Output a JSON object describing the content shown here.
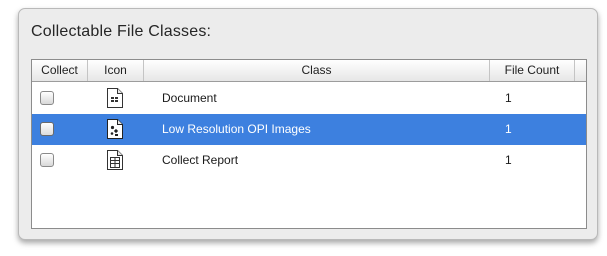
{
  "panel": {
    "title": "Collectable File Classes:"
  },
  "table": {
    "columns": {
      "collect": "Collect",
      "icon": "Icon",
      "class": "Class",
      "file_count": "File Count"
    },
    "rows": [
      {
        "icon": "document-icon",
        "class": "Document",
        "file_count": "1",
        "collect": false,
        "selected": false
      },
      {
        "icon": "image-document-icon",
        "class": "Low Resolution OPI Images",
        "file_count": "1",
        "collect": false,
        "selected": true
      },
      {
        "icon": "report-document-icon",
        "class": "Collect Report",
        "file_count": "1",
        "collect": false,
        "selected": false
      }
    ]
  },
  "colors": {
    "selection": "#3d80df",
    "panel_background": "#ececec"
  }
}
